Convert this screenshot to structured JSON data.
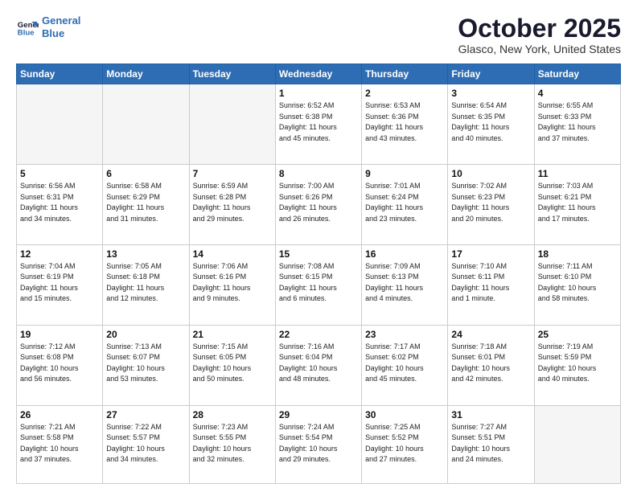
{
  "header": {
    "logo_line1": "General",
    "logo_line2": "Blue",
    "month": "October 2025",
    "location": "Glasco, New York, United States"
  },
  "weekdays": [
    "Sunday",
    "Monday",
    "Tuesday",
    "Wednesday",
    "Thursday",
    "Friday",
    "Saturday"
  ],
  "weeks": [
    [
      {
        "day": "",
        "info": ""
      },
      {
        "day": "",
        "info": ""
      },
      {
        "day": "",
        "info": ""
      },
      {
        "day": "1",
        "info": "Sunrise: 6:52 AM\nSunset: 6:38 PM\nDaylight: 11 hours\nand 45 minutes."
      },
      {
        "day": "2",
        "info": "Sunrise: 6:53 AM\nSunset: 6:36 PM\nDaylight: 11 hours\nand 43 minutes."
      },
      {
        "day": "3",
        "info": "Sunrise: 6:54 AM\nSunset: 6:35 PM\nDaylight: 11 hours\nand 40 minutes."
      },
      {
        "day": "4",
        "info": "Sunrise: 6:55 AM\nSunset: 6:33 PM\nDaylight: 11 hours\nand 37 minutes."
      }
    ],
    [
      {
        "day": "5",
        "info": "Sunrise: 6:56 AM\nSunset: 6:31 PM\nDaylight: 11 hours\nand 34 minutes."
      },
      {
        "day": "6",
        "info": "Sunrise: 6:58 AM\nSunset: 6:29 PM\nDaylight: 11 hours\nand 31 minutes."
      },
      {
        "day": "7",
        "info": "Sunrise: 6:59 AM\nSunset: 6:28 PM\nDaylight: 11 hours\nand 29 minutes."
      },
      {
        "day": "8",
        "info": "Sunrise: 7:00 AM\nSunset: 6:26 PM\nDaylight: 11 hours\nand 26 minutes."
      },
      {
        "day": "9",
        "info": "Sunrise: 7:01 AM\nSunset: 6:24 PM\nDaylight: 11 hours\nand 23 minutes."
      },
      {
        "day": "10",
        "info": "Sunrise: 7:02 AM\nSunset: 6:23 PM\nDaylight: 11 hours\nand 20 minutes."
      },
      {
        "day": "11",
        "info": "Sunrise: 7:03 AM\nSunset: 6:21 PM\nDaylight: 11 hours\nand 17 minutes."
      }
    ],
    [
      {
        "day": "12",
        "info": "Sunrise: 7:04 AM\nSunset: 6:19 PM\nDaylight: 11 hours\nand 15 minutes."
      },
      {
        "day": "13",
        "info": "Sunrise: 7:05 AM\nSunset: 6:18 PM\nDaylight: 11 hours\nand 12 minutes."
      },
      {
        "day": "14",
        "info": "Sunrise: 7:06 AM\nSunset: 6:16 PM\nDaylight: 11 hours\nand 9 minutes."
      },
      {
        "day": "15",
        "info": "Sunrise: 7:08 AM\nSunset: 6:15 PM\nDaylight: 11 hours\nand 6 minutes."
      },
      {
        "day": "16",
        "info": "Sunrise: 7:09 AM\nSunset: 6:13 PM\nDaylight: 11 hours\nand 4 minutes."
      },
      {
        "day": "17",
        "info": "Sunrise: 7:10 AM\nSunset: 6:11 PM\nDaylight: 11 hours\nand 1 minute."
      },
      {
        "day": "18",
        "info": "Sunrise: 7:11 AM\nSunset: 6:10 PM\nDaylight: 10 hours\nand 58 minutes."
      }
    ],
    [
      {
        "day": "19",
        "info": "Sunrise: 7:12 AM\nSunset: 6:08 PM\nDaylight: 10 hours\nand 56 minutes."
      },
      {
        "day": "20",
        "info": "Sunrise: 7:13 AM\nSunset: 6:07 PM\nDaylight: 10 hours\nand 53 minutes."
      },
      {
        "day": "21",
        "info": "Sunrise: 7:15 AM\nSunset: 6:05 PM\nDaylight: 10 hours\nand 50 minutes."
      },
      {
        "day": "22",
        "info": "Sunrise: 7:16 AM\nSunset: 6:04 PM\nDaylight: 10 hours\nand 48 minutes."
      },
      {
        "day": "23",
        "info": "Sunrise: 7:17 AM\nSunset: 6:02 PM\nDaylight: 10 hours\nand 45 minutes."
      },
      {
        "day": "24",
        "info": "Sunrise: 7:18 AM\nSunset: 6:01 PM\nDaylight: 10 hours\nand 42 minutes."
      },
      {
        "day": "25",
        "info": "Sunrise: 7:19 AM\nSunset: 5:59 PM\nDaylight: 10 hours\nand 40 minutes."
      }
    ],
    [
      {
        "day": "26",
        "info": "Sunrise: 7:21 AM\nSunset: 5:58 PM\nDaylight: 10 hours\nand 37 minutes."
      },
      {
        "day": "27",
        "info": "Sunrise: 7:22 AM\nSunset: 5:57 PM\nDaylight: 10 hours\nand 34 minutes."
      },
      {
        "day": "28",
        "info": "Sunrise: 7:23 AM\nSunset: 5:55 PM\nDaylight: 10 hours\nand 32 minutes."
      },
      {
        "day": "29",
        "info": "Sunrise: 7:24 AM\nSunset: 5:54 PM\nDaylight: 10 hours\nand 29 minutes."
      },
      {
        "day": "30",
        "info": "Sunrise: 7:25 AM\nSunset: 5:52 PM\nDaylight: 10 hours\nand 27 minutes."
      },
      {
        "day": "31",
        "info": "Sunrise: 7:27 AM\nSunset: 5:51 PM\nDaylight: 10 hours\nand 24 minutes."
      },
      {
        "day": "",
        "info": ""
      }
    ]
  ]
}
